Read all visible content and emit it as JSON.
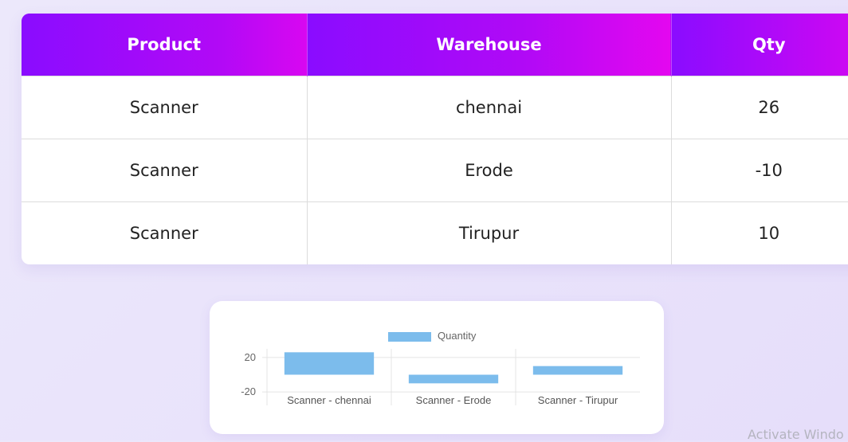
{
  "table": {
    "headers": [
      "Product",
      "Warehouse",
      "Qty"
    ],
    "rows": [
      [
        "Scanner",
        "chennai",
        "26"
      ],
      [
        "Scanner",
        "Erode",
        "-10"
      ],
      [
        "Scanner",
        "Tirupur",
        "10"
      ]
    ]
  },
  "chart_data": {
    "type": "bar",
    "categories": [
      "Scanner - chennai",
      "Scanner - Erode",
      "Scanner - Tirupur"
    ],
    "series": [
      {
        "name": "Quantity",
        "values": [
          26,
          -10,
          10
        ],
        "color": "#7cbcec"
      }
    ],
    "yticks": [
      "20",
      "-20"
    ],
    "ylim": [
      -30,
      30
    ],
    "legend": "top"
  },
  "watermark": "Activate Windo"
}
